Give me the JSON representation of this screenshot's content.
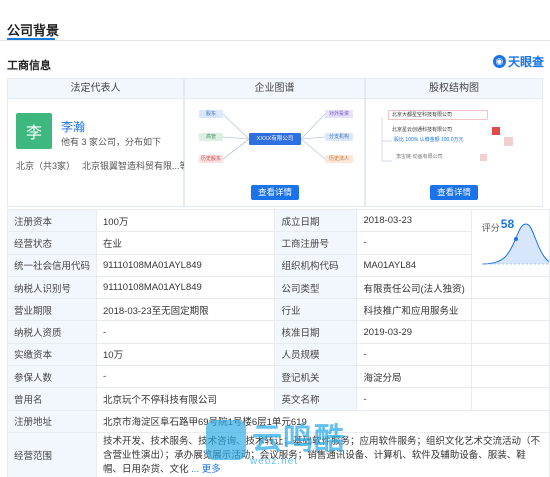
{
  "header": {
    "title": "公司背景",
    "subtitle": "工商信息",
    "brand": "天眼查"
  },
  "panels": {
    "legal_rep": {
      "head": "法定代表人",
      "avatar_char": "李",
      "name": "李瀚",
      "desc": "他有 3 家公司，分布如下",
      "loc": "北京（共3家）",
      "loc_detail": "北京银翼智造科贸有限...等"
    },
    "graph": {
      "head": "企业图谱",
      "button": "查看详情",
      "center": "XXXX有限公司",
      "left_nodes": [
        "股东",
        "高管",
        "历史股东"
      ],
      "right_nodes": [
        "对外投资",
        "分支机构",
        "历史法人"
      ]
    },
    "equity": {
      "head": "股权结构图",
      "button": "查看详情",
      "top": "北京大都星空科技有限公司",
      "mid": "北京星云创通科技有限公司",
      "mid_sub": "股比 100%   认缴金额 100.0万元",
      "bottom": "李宝链·动画有限公司"
    }
  },
  "table": {
    "rows": [
      {
        "k1": "注册资本",
        "v1": "100万",
        "k2": "成立日期",
        "v2": "2018-03-23"
      },
      {
        "k1": "经营状态",
        "v1": "在业",
        "k2": "工商注册号",
        "v2": "-"
      },
      {
        "k1": "统一社会信用代码",
        "v1": "91110108MA01AYL849",
        "k2": "组织机构代码",
        "v2": "MA01AYL84"
      },
      {
        "k1": "纳税人识别号",
        "v1": "91110108MA01AYL849",
        "k2": "公司类型",
        "v2": "有限责任公司(法人独资)"
      },
      {
        "k1": "营业期限",
        "v1": "2018-03-23至无固定期限",
        "k2": "行业",
        "v2": "科技推广和应用服务业"
      },
      {
        "k1": "纳税人资质",
        "v1": "-",
        "k2": "核准日期",
        "v2": "2019-03-29"
      },
      {
        "k1": "实缴资本",
        "v1": "10万",
        "k2": "人员规模",
        "v2": "-"
      },
      {
        "k1": "参保人数",
        "v1": "-",
        "k2": "登记机关",
        "v2": "海淀分局"
      },
      {
        "k1": "曾用名",
        "v1": "北京玩个不停科技有限公司",
        "k2": "英文名称",
        "v2": "-"
      }
    ],
    "address": {
      "k": "注册地址",
      "v": "北京市海淀区阜石路甲69号院1号楼6层1单元619"
    },
    "scope": {
      "k": "经营范围",
      "v": "技术开发、技术服务、技术咨询、技术转让；基础软件服务；应用软件服务；组织文化艺术交流活动（不含营业性演出）；承办展览展示活动；会议服务；销售通讯设备、计算机、软件及辅助设备、服装、鞋帽、日用杂货、文化",
      "more": "... 更多"
    },
    "score": {
      "label": "评分",
      "value": "58"
    }
  },
  "watermark": {
    "text": "云鸣酷",
    "url": "webz.net"
  }
}
